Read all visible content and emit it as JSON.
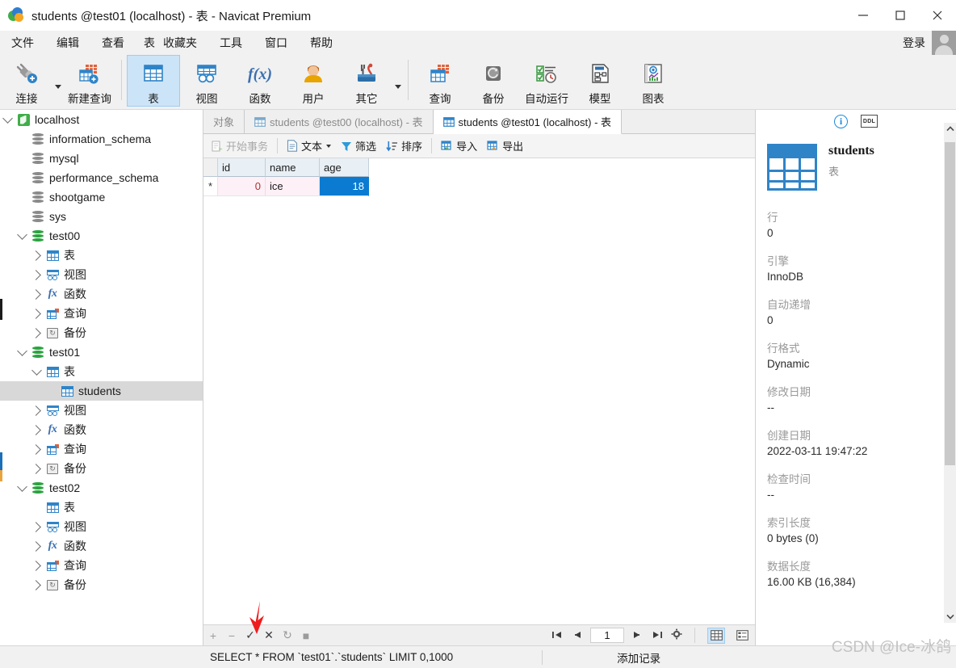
{
  "window": {
    "title": "students @test01 (localhost) - 表 - Navicat Premium",
    "minimize": "—",
    "maximize": "☐",
    "close": "✕"
  },
  "menubar": {
    "items": [
      "文件",
      "编辑",
      "查看",
      "表",
      "收藏夹",
      "工具",
      "窗口",
      "帮助"
    ],
    "login_label": "登录"
  },
  "toolbar": {
    "groups": [
      {
        "buttons": [
          {
            "label": "连接",
            "icon": "connection-icon",
            "has_dropdown": true
          },
          {
            "label": "新建查询",
            "icon": "new-query-icon",
            "has_dropdown": false
          }
        ]
      },
      {
        "buttons": [
          {
            "label": "表",
            "icon": "table-icon",
            "selected": true
          },
          {
            "label": "视图",
            "icon": "view-icon"
          },
          {
            "label": "函数",
            "icon": "function-icon"
          },
          {
            "label": "用户",
            "icon": "user-icon"
          },
          {
            "label": "其它",
            "icon": "other-icon",
            "has_dropdown": true
          }
        ]
      },
      {
        "buttons": [
          {
            "label": "查询",
            "icon": "query-icon"
          },
          {
            "label": "备份",
            "icon": "backup-icon"
          },
          {
            "label": "自动运行",
            "icon": "automation-icon"
          },
          {
            "label": "模型",
            "icon": "model-icon"
          },
          {
            "label": "图表",
            "icon": "chart-icon"
          }
        ]
      }
    ]
  },
  "sidebar": {
    "nodes": [
      {
        "label": "localhost",
        "icon": "navicat-server-icon",
        "depth": 0,
        "twisty": "down"
      },
      {
        "label": "information_schema",
        "icon": "database-gray-icon",
        "depth": 1,
        "twisty": "none"
      },
      {
        "label": "mysql",
        "icon": "database-gray-icon",
        "depth": 1,
        "twisty": "none"
      },
      {
        "label": "performance_schema",
        "icon": "database-gray-icon",
        "depth": 1,
        "twisty": "none"
      },
      {
        "label": "shootgame",
        "icon": "database-gray-icon",
        "depth": 1,
        "twisty": "none"
      },
      {
        "label": "sys",
        "icon": "database-gray-icon",
        "depth": 1,
        "twisty": "none"
      },
      {
        "label": "test00",
        "icon": "database-green-icon",
        "depth": 1,
        "twisty": "down"
      },
      {
        "label": "表",
        "icon": "table-icon",
        "depth": 2,
        "twisty": "right"
      },
      {
        "label": "视图",
        "icon": "view-icon",
        "depth": 2,
        "twisty": "right"
      },
      {
        "label": "函数",
        "icon": "function-icon",
        "depth": 2,
        "twisty": "right"
      },
      {
        "label": "查询",
        "icon": "query-icon",
        "depth": 2,
        "twisty": "right"
      },
      {
        "label": "备份",
        "icon": "backup-icon",
        "depth": 2,
        "twisty": "right"
      },
      {
        "label": "test01",
        "icon": "database-green-icon",
        "depth": 1,
        "twisty": "down"
      },
      {
        "label": "表",
        "icon": "table-icon",
        "depth": 2,
        "twisty": "down"
      },
      {
        "label": "students",
        "icon": "table-icon",
        "depth": 3,
        "twisty": "none",
        "selected": true
      },
      {
        "label": "视图",
        "icon": "view-icon",
        "depth": 2,
        "twisty": "right"
      },
      {
        "label": "函数",
        "icon": "function-icon",
        "depth": 2,
        "twisty": "right"
      },
      {
        "label": "查询",
        "icon": "query-icon",
        "depth": 2,
        "twisty": "right"
      },
      {
        "label": "备份",
        "icon": "backup-icon",
        "depth": 2,
        "twisty": "right"
      },
      {
        "label": "test02",
        "icon": "database-green-icon",
        "depth": 1,
        "twisty": "down"
      },
      {
        "label": "表",
        "icon": "table-icon",
        "depth": 2,
        "twisty": "none"
      },
      {
        "label": "视图",
        "icon": "view-icon",
        "depth": 2,
        "twisty": "right"
      },
      {
        "label": "函数",
        "icon": "function-icon",
        "depth": 2,
        "twisty": "right"
      },
      {
        "label": "查询",
        "icon": "query-icon",
        "depth": 2,
        "twisty": "right"
      },
      {
        "label": "备份",
        "icon": "backup-icon",
        "depth": 2,
        "twisty": "right"
      }
    ]
  },
  "tabs": [
    {
      "label": "对象",
      "icon": "none",
      "active": false
    },
    {
      "label": "students @test00 (localhost) - 表",
      "icon": "table-icon",
      "active": false
    },
    {
      "label": "students @test01 (localhost) - 表",
      "icon": "table-icon",
      "active": true
    }
  ],
  "gridbar": {
    "begin_transaction": "开始事务",
    "text": "文本",
    "filter": "筛选",
    "sort": "排序",
    "import": "导入",
    "export": "导出"
  },
  "datagrid": {
    "columns": [
      "id",
      "name",
      "age"
    ],
    "rows": [
      {
        "marker": "*",
        "id": "0",
        "name": "ice",
        "age": "18"
      }
    ],
    "selected_cell": "age"
  },
  "navstrip": {
    "add_row": "+",
    "delete_row": "−",
    "apply": "✓",
    "cancel": "✕",
    "refresh": "↻",
    "stop": "■",
    "first_page": "❘◀",
    "prev_page": "◀",
    "page_number": "1",
    "next_page": "▶",
    "last_page": "▶❘",
    "settings": "⚙",
    "grid_view": "grid-view-icon",
    "form_view": "form-view-icon"
  },
  "infopanel": {
    "tab_info": "info-icon",
    "tab_ddl": "DDL",
    "object_name": "students",
    "object_type": "表",
    "fields": [
      {
        "key": "行",
        "value": "0"
      },
      {
        "key": "引擎",
        "value": "InnoDB"
      },
      {
        "key": "自动递增",
        "value": "0"
      },
      {
        "key": "行格式",
        "value": "Dynamic"
      },
      {
        "key": "修改日期",
        "value": "--"
      },
      {
        "key": "创建日期",
        "value": "2022-03-11 19:47:22"
      },
      {
        "key": "检查时间",
        "value": "--"
      },
      {
        "key": "索引长度",
        "value": "0 bytes (0)"
      },
      {
        "key": "数据长度",
        "value": "16.00 KB (16,384)"
      }
    ]
  },
  "statusbar": {
    "sql": "SELECT * FROM `test01`.`students` LIMIT 0,1000",
    "message": "添加记录"
  },
  "watermark": "CSDN @Ice-冰鸽",
  "colors": {
    "accent": "#0a7bd1",
    "selection": "#cce4f7",
    "chrome": "#f1f1f1",
    "edited_cell": "#fdf0f6",
    "annotation": "#ee1c1c"
  }
}
